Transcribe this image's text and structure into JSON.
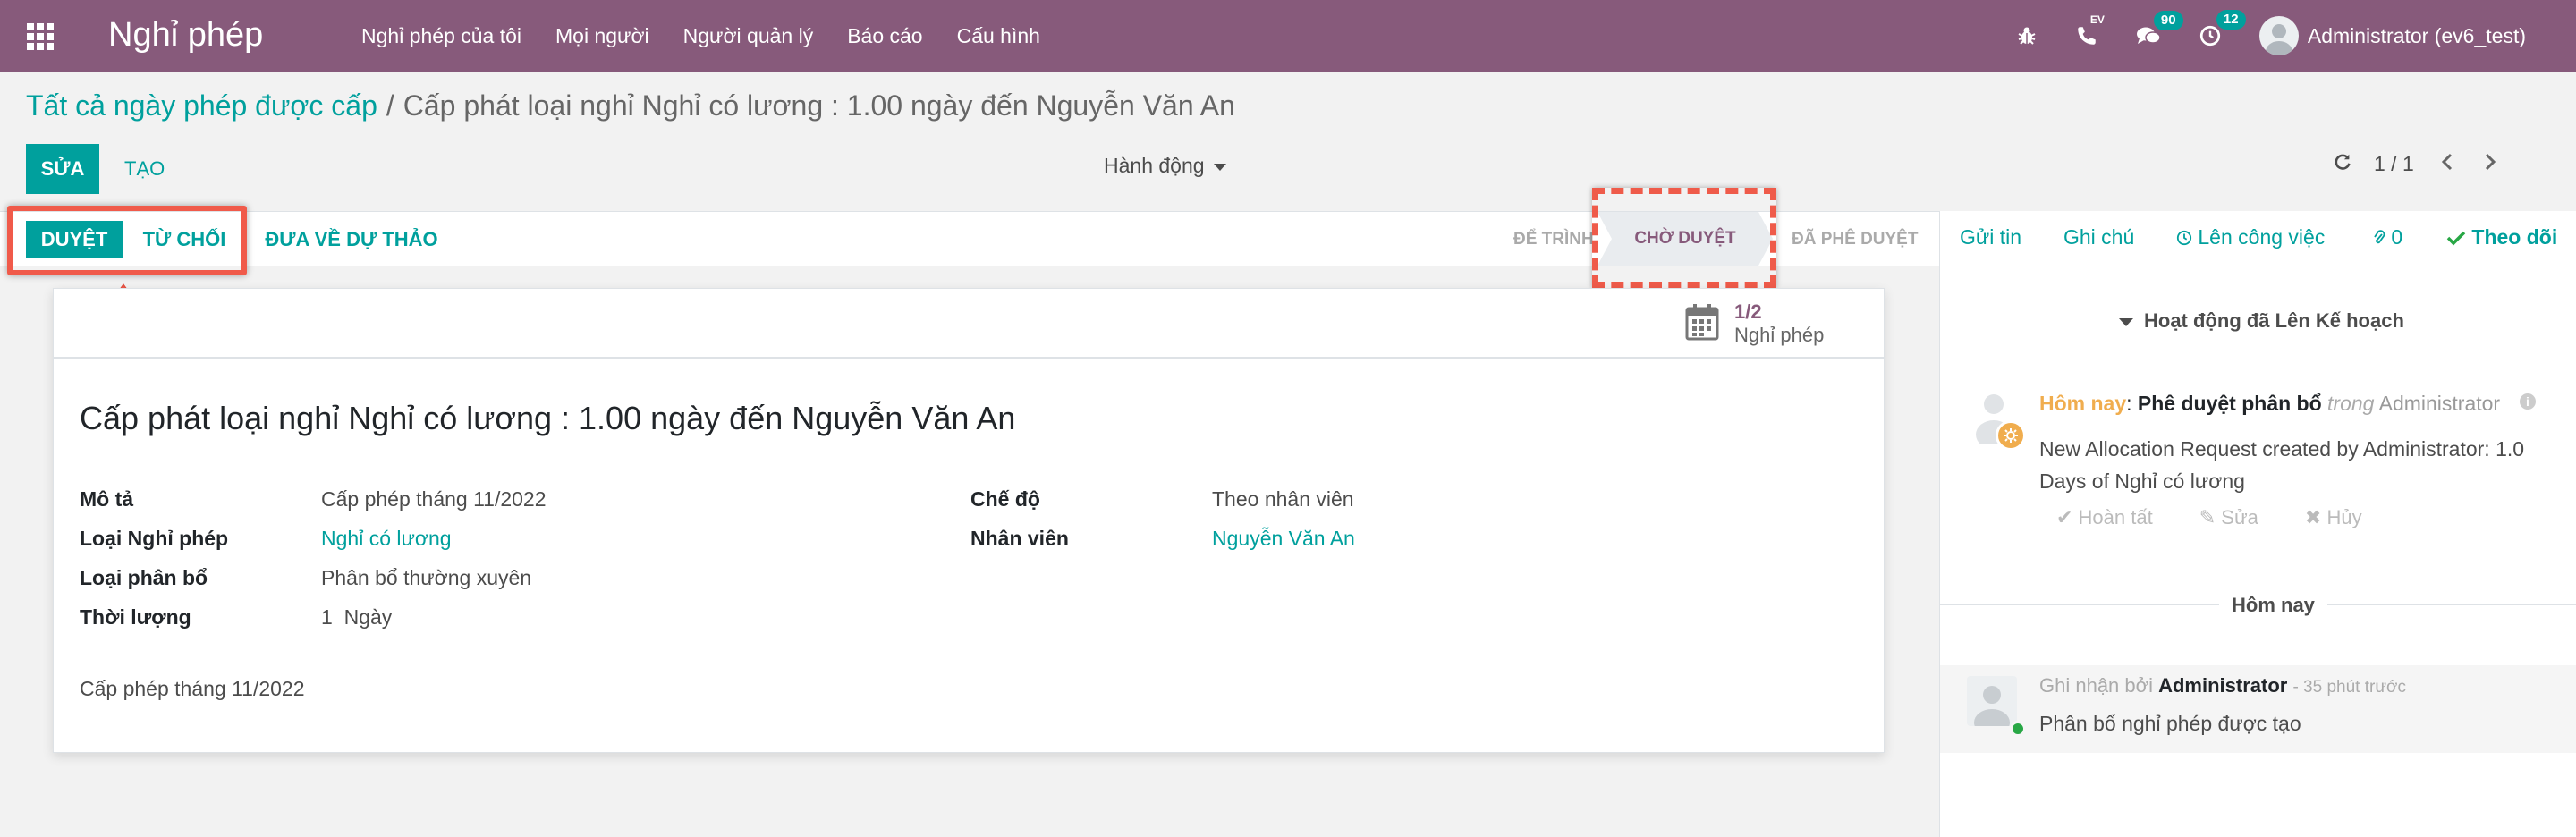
{
  "navbar": {
    "app_title": "Nghỉ phép",
    "menu": [
      "Nghỉ phép của tôi",
      "Mọi người",
      "Người quản lý",
      "Báo cáo",
      "Cấu hình"
    ],
    "phone_tag": "EV",
    "messages_count": "90",
    "activities_count": "12",
    "user": "Administrator (ev6_test)"
  },
  "breadcrumb": {
    "parent": "Tất cả ngày phép được cấp",
    "separator": "/",
    "current": "Cấp phát loại nghỉ Nghỉ có lương : 1.00 ngày đến Nguyễn Văn An"
  },
  "toolbar": {
    "edit_label": "SỬA",
    "create_label": "TẠO",
    "actions_label": "Hành động",
    "pager_value": "1 / 1"
  },
  "statusbar": {
    "approve_label": "DUYỆT",
    "refuse_label": "TỪ CHỐI",
    "reset_label": "ĐƯA VỀ DỰ THẢO",
    "stages": [
      "ĐỂ TRÌNH",
      "CHỜ DUYỆT",
      "ĐÃ PHÊ DUYỆT"
    ],
    "current_stage": "CHỜ DUYỆT"
  },
  "form": {
    "smart_button": {
      "value": "1/2",
      "label": "Nghỉ phép"
    },
    "title": "Cấp phát loại nghỉ Nghỉ có lương : 1.00 ngày đến Nguyễn Văn An",
    "left_fields": [
      {
        "label": "Mô tả",
        "value": "Cấp phép tháng 11/2022"
      },
      {
        "label": "Loại Nghỉ phép",
        "value": "Nghỉ có lương"
      },
      {
        "label": "Loại phân bổ",
        "value": "Phân bổ thường xuyên"
      },
      {
        "label": "Thời lượng",
        "value": "1  Ngày"
      }
    ],
    "right_fields": [
      {
        "label": "Chế độ",
        "value": "Theo nhân viên"
      },
      {
        "label": "Nhân viên",
        "value": "Nguyễn Văn An"
      }
    ],
    "notes": "Cấp phép tháng 11/2022"
  },
  "chatter": {
    "send_message": "Gửi tin",
    "log_note": "Ghi chú",
    "schedule_activity": "Lên công việc",
    "attachments_count": "0",
    "follow": "Theo dõi",
    "planned_header": "Hoạt động đã Lên Kế hoạch",
    "activity": {
      "when": "Hôm nay",
      "colon": ":",
      "type": "Phê duyệt phân bổ",
      "in_word": "trong",
      "user": "Administrator",
      "note": "New Allocation Request created by Administrator: 1.0 Days of Nghỉ có lương",
      "done": "Hoàn tất",
      "edit": "Sửa",
      "cancel": "Hủy"
    },
    "today_separator": "Hôm nay",
    "message": {
      "by": "Ghi nhận bởi",
      "author": "Administrator",
      "date": "- 35 phút trước",
      "body": "Phân bổ nghỉ phép được tạo"
    }
  },
  "colors": {
    "brand": "#875a7b",
    "accent": "#00a09d",
    "highlight": "#f05a4a",
    "activity_today": "#f0ad4e"
  }
}
